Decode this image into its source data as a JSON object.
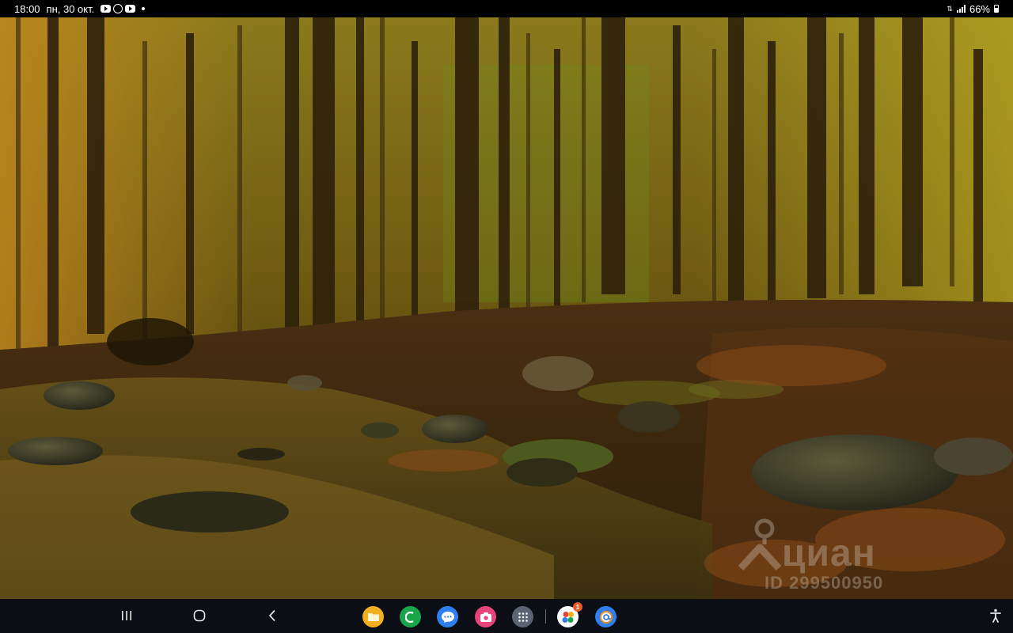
{
  "status_bar": {
    "time": "18:00",
    "date": "пн, 30 окт.",
    "notification_icons": [
      "youtube-icon",
      "whatsapp-icon",
      "youtube-icon"
    ],
    "battery_percent": "66%"
  },
  "photo": {
    "watermark_logo": "циан",
    "watermark_id": "ID 299500950"
  },
  "navigation": {
    "buttons": [
      "recent-apps",
      "home",
      "back"
    ],
    "apps": [
      {
        "name": "my-files-icon",
        "color": "#f2b01e"
      },
      {
        "name": "phone-icon",
        "color": "#1aa54b"
      },
      {
        "name": "messages-icon",
        "color": "#2f7ff0"
      },
      {
        "name": "screen-recorder-icon",
        "color": "#e8437a"
      },
      {
        "name": "app-drawer-icon",
        "color": "#5a6472"
      },
      {
        "name": "gallery-icon",
        "color": "#ffffff"
      },
      {
        "name": "email-icon",
        "color": "#2f7ff0"
      }
    ],
    "gallery_badge": "1"
  }
}
